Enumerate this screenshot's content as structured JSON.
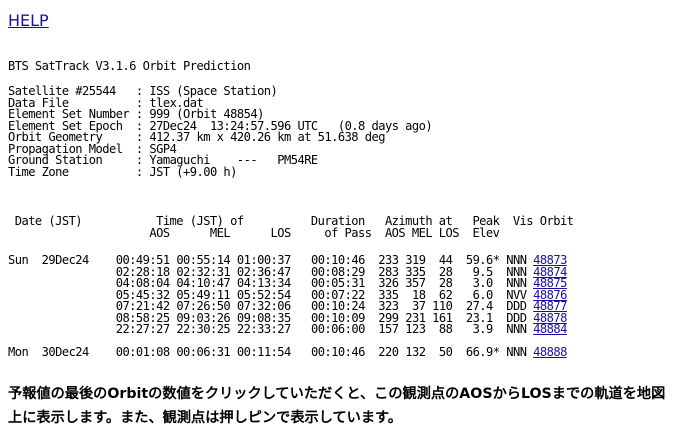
{
  "help_link": "HELP",
  "title": "BTS SatTrack V3.1.6 Orbit Prediction",
  "info": [
    {
      "label": "Satellite #25544  ",
      "value": "ISS (Space Station)"
    },
    {
      "label": "Data File         ",
      "value": "tlex.dat"
    },
    {
      "label": "Element Set Number",
      "value": "999 (Orbit 48854)"
    },
    {
      "label": "Element Set Epoch ",
      "value": "27Dec24  13:24:57.596 UTC   (0.8 days ago)"
    },
    {
      "label": "Orbit Geometry    ",
      "value": "412.37 km x 420.26 km at 51.638 deg"
    },
    {
      "label": "Propagation Model ",
      "value": "SGP4"
    },
    {
      "label": "Ground Station    ",
      "value": "Yamaguchi    ---   PM54RE"
    },
    {
      "label": "Time Zone         ",
      "value": "JST (+9.00 h)"
    }
  ],
  "table_header": {
    "line1": " Date (JST)           Time (JST) of          Duration   Azimuth at   Peak  Vis Orbit",
    "line2": "                     AOS      MEL      LOS     of Pass  AOS MEL LOS  Elev"
  },
  "passes": [
    {
      "date": "Sun  29Dec24",
      "aos": "00:49:51",
      "mel": "00:55:14",
      "los": "01:00:37",
      "duration": "00:10:46",
      "az_aos": "233",
      "az_mel": "319",
      "az_los": "44",
      "peak": "59.6*",
      "vis": "NNN",
      "orbit": "48873"
    },
    {
      "date": "",
      "aos": "02:28:18",
      "mel": "02:32:31",
      "los": "02:36:47",
      "duration": "00:08:29",
      "az_aos": "283",
      "az_mel": "335",
      "az_los": "28",
      "peak": "9.5",
      "vis": "NNN",
      "orbit": "48874"
    },
    {
      "date": "",
      "aos": "04:08:04",
      "mel": "04:10:47",
      "los": "04:13:34",
      "duration": "00:05:31",
      "az_aos": "326",
      "az_mel": "357",
      "az_los": "28",
      "peak": "3.0",
      "vis": "NNN",
      "orbit": "48875"
    },
    {
      "date": "",
      "aos": "05:45:32",
      "mel": "05:49:11",
      "los": "05:52:54",
      "duration": "00:07:22",
      "az_aos": "335",
      "az_mel": "18",
      "az_los": "62",
      "peak": "6.0",
      "vis": "NVV",
      "orbit": "48876"
    },
    {
      "date": "",
      "aos": "07:21:42",
      "mel": "07:26:50",
      "los": "07:32:06",
      "duration": "00:10:24",
      "az_aos": "323",
      "az_mel": "37",
      "az_los": "110",
      "peak": "27.4",
      "vis": "DDD",
      "orbit": "48877"
    },
    {
      "date": "",
      "aos": "08:58:25",
      "mel": "09:03:26",
      "los": "09:08:35",
      "duration": "00:10:09",
      "az_aos": "299",
      "az_mel": "231",
      "az_los": "161",
      "peak": "23.1",
      "vis": "DDD",
      "orbit": "48878"
    },
    {
      "date": "",
      "aos": "22:27:27",
      "mel": "22:30:25",
      "los": "22:33:27",
      "duration": "00:06:00",
      "az_aos": "157",
      "az_mel": "123",
      "az_los": "88",
      "peak": "3.9",
      "vis": "NNN",
      "orbit": "48884"
    },
    {
      "date": "",
      "aos": "",
      "mel": "",
      "los": "",
      "duration": "",
      "az_aos": "",
      "az_mel": "",
      "az_los": "",
      "peak": "",
      "vis": "",
      "orbit": ""
    },
    {
      "date": "Mon  30Dec24",
      "aos": "00:01:08",
      "mel": "00:06:31",
      "los": "00:11:54",
      "duration": "00:10:46",
      "az_aos": "220",
      "az_mel": "132",
      "az_los": "50",
      "peak": "66.9*",
      "vis": "NNN",
      "orbit": "48888"
    }
  ],
  "note": "予報値の最後のOrbitの数値をクリックしていただくと、この観測点のAOSからLOSまでの軌道を地図上に表示します。また、観測点は押しピンで表示しています。"
}
